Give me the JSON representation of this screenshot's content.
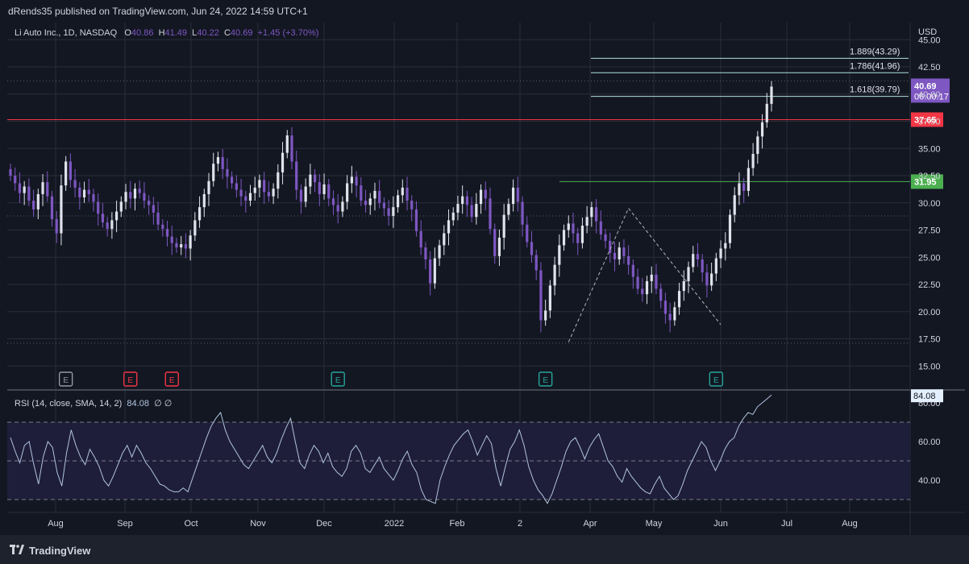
{
  "header": {
    "published": "dRends35 published on TradingView.com, Jun 24, 2022 14:59 UTC+1"
  },
  "legend": {
    "symbol": "Li Auto Inc., 1D, NASDAQ",
    "o_label": "O",
    "o": "40.86",
    "h_label": "H",
    "h": "41.49",
    "l_label": "L",
    "l": "40.22",
    "c_label": "C",
    "c": "40.69",
    "change": "+1.45 (+3.70%)"
  },
  "rsi_legend": {
    "label": "RSI (14, close, SMA, 14, 2)",
    "value": "84.08",
    "extra": "∅ ∅"
  },
  "footer": {
    "brand": "TradingView"
  },
  "colors": {
    "bg": "#131722",
    "grid": "#2a2e39",
    "up": "#e0e3eb",
    "down": "#7e57c2",
    "red": "#f23645",
    "green": "#4caf50",
    "fib": "#b2dfdb",
    "rsi": "#b0c4de",
    "rsi_band": "#1f1e3a"
  },
  "chart_data": [
    {
      "type": "candlestick",
      "title": "Li Auto Inc., 1D, NASDAQ",
      "currency": "USD",
      "y_ticks": [
        "15.00",
        "17.50",
        "20.00",
        "22.50",
        "25.00",
        "27.50",
        "30.00",
        "32.50",
        "35.00",
        "37.50",
        "40.00",
        "42.50",
        "45.00"
      ],
      "ylim": [
        15,
        47.5
      ],
      "x_ticks": [
        "Aug",
        "Sep",
        "Oct",
        "Nov",
        "Dec",
        "2022",
        "Feb",
        "2",
        "Apr",
        "May",
        "Jun",
        "Jul",
        "Aug"
      ],
      "closes": [
        32.5,
        31.8,
        30.9,
        31.5,
        30.2,
        29.4,
        30.8,
        31.9,
        30.6,
        28.5,
        27.2,
        31.6,
        33.8,
        32.1,
        31.4,
        30.5,
        31.2,
        30.8,
        30.1,
        29.0,
        28.2,
        27.6,
        28.4,
        29.2,
        30.1,
        31.0,
        30.4,
        31.3,
        30.9,
        30.2,
        29.8,
        29.1,
        28.0,
        27.6,
        26.9,
        26.3,
        25.9,
        26.2,
        25.8,
        27.0,
        28.4,
        29.6,
        30.8,
        32.0,
        33.6,
        34.2,
        33.1,
        32.4,
        31.8,
        31.2,
        30.6,
        30.2,
        30.9,
        31.4,
        32.1,
        31.0,
        30.6,
        31.3,
        32.8,
        34.6,
        36.2,
        33.8,
        31.2,
        30.1,
        31.5,
        32.6,
        31.9,
        30.8,
        31.7,
        30.4,
        29.8,
        29.2,
        30.1,
        31.8,
        32.4,
        31.6,
        30.2,
        29.8,
        30.4,
        31.1,
        30.0,
        29.5,
        28.8,
        29.6,
        30.7,
        31.4,
        30.2,
        29.4,
        27.4,
        25.9,
        24.8,
        22.6,
        24.9,
        26.1,
        27.2,
        28.4,
        29.1,
        29.9,
        30.6,
        29.8,
        28.7,
        29.9,
        31.2,
        30.4,
        27.6,
        25.1,
        26.8,
        28.9,
        29.9,
        31.4,
        30.1,
        28.0,
        26.4,
        25.2,
        23.8,
        19.2,
        20.1,
        22.4,
        24.3,
        26.1,
        27.5,
        28.1,
        27.2,
        26.3,
        27.9,
        28.7,
        29.6,
        28.3,
        27.1,
        26.5,
        25.4,
        24.8,
        25.9,
        25.1,
        24.3,
        23.2,
        22.1,
        21.6,
        22.8,
        23.4,
        22.1,
        21.0,
        19.8,
        19.2,
        20.4,
        21.9,
        22.8,
        24.1,
        25.3,
        24.8,
        23.6,
        22.4,
        23.5,
        24.9,
        25.8,
        26.3,
        28.9,
        30.7,
        31.8,
        31.1,
        33.2,
        34.5,
        36.1,
        37.4,
        39.1,
        40.69
      ],
      "hlines": [
        {
          "label": "37.65",
          "value": 37.65,
          "color": "red"
        },
        {
          "label": "31.95",
          "value": 31.95,
          "color": "green"
        }
      ],
      "fib_levels": [
        {
          "label": "1.618(39.79)",
          "value": 39.79
        },
        {
          "label": "1.786(41.96)",
          "value": 41.96
        },
        {
          "label": "1.889(43.29)",
          "value": 43.29
        }
      ],
      "last_price": {
        "value": "40.69",
        "countdown": "06:00:17"
      },
      "zigzag": [
        {
          "x": 121,
          "y": 17.2
        },
        {
          "x": 134,
          "y": 29.5
        },
        {
          "x": 154,
          "y": 18.8
        }
      ],
      "earnings_markers": [
        {
          "x": 12,
          "label": "E",
          "color": "gray"
        },
        {
          "x": 26,
          "label": "E",
          "color": "red"
        },
        {
          "x": 35,
          "label": "E",
          "color": "red"
        },
        {
          "x": 71,
          "label": "E",
          "color": "teal"
        },
        {
          "x": 116,
          "label": "E",
          "color": "teal"
        },
        {
          "x": 153,
          "label": "E",
          "color": "teal"
        }
      ]
    },
    {
      "type": "line",
      "title": "RSI (14, close, SMA, 14, 2)",
      "y_ticks": [
        "40.00",
        "60.00",
        "80.00"
      ],
      "ylim": [
        28,
        90
      ],
      "bands": [
        30,
        50,
        70
      ],
      "last_value": "84.08",
      "values": [
        62,
        55,
        49,
        58,
        60,
        48,
        38,
        52,
        60,
        57,
        44,
        37,
        54,
        66,
        58,
        52,
        48,
        56,
        52,
        47,
        40,
        37,
        42,
        48,
        54,
        58,
        52,
        58,
        54,
        49,
        46,
        42,
        38,
        37,
        35,
        34,
        34,
        36,
        34,
        41,
        48,
        55,
        62,
        68,
        72,
        75,
        66,
        60,
        56,
        52,
        48,
        46,
        50,
        54,
        58,
        52,
        49,
        54,
        61,
        67,
        72,
        60,
        49,
        46,
        53,
        58,
        55,
        49,
        54,
        47,
        44,
        42,
        46,
        55,
        58,
        54,
        46,
        44,
        48,
        52,
        46,
        43,
        40,
        45,
        51,
        55,
        48,
        44,
        35,
        30,
        29,
        28,
        40,
        47,
        53,
        58,
        61,
        64,
        66,
        60,
        53,
        58,
        63,
        59,
        46,
        37,
        47,
        56,
        60,
        66,
        58,
        47,
        40,
        35,
        32,
        28,
        33,
        40,
        47,
        55,
        60,
        62,
        57,
        51,
        57,
        61,
        64,
        57,
        50,
        47,
        42,
        39,
        46,
        42,
        39,
        36,
        34,
        33,
        38,
        42,
        36,
        33,
        30,
        32,
        38,
        45,
        50,
        55,
        60,
        57,
        50,
        45,
        50,
        56,
        60,
        62,
        68,
        72,
        75,
        74,
        78,
        80,
        82,
        84.08
      ]
    }
  ]
}
